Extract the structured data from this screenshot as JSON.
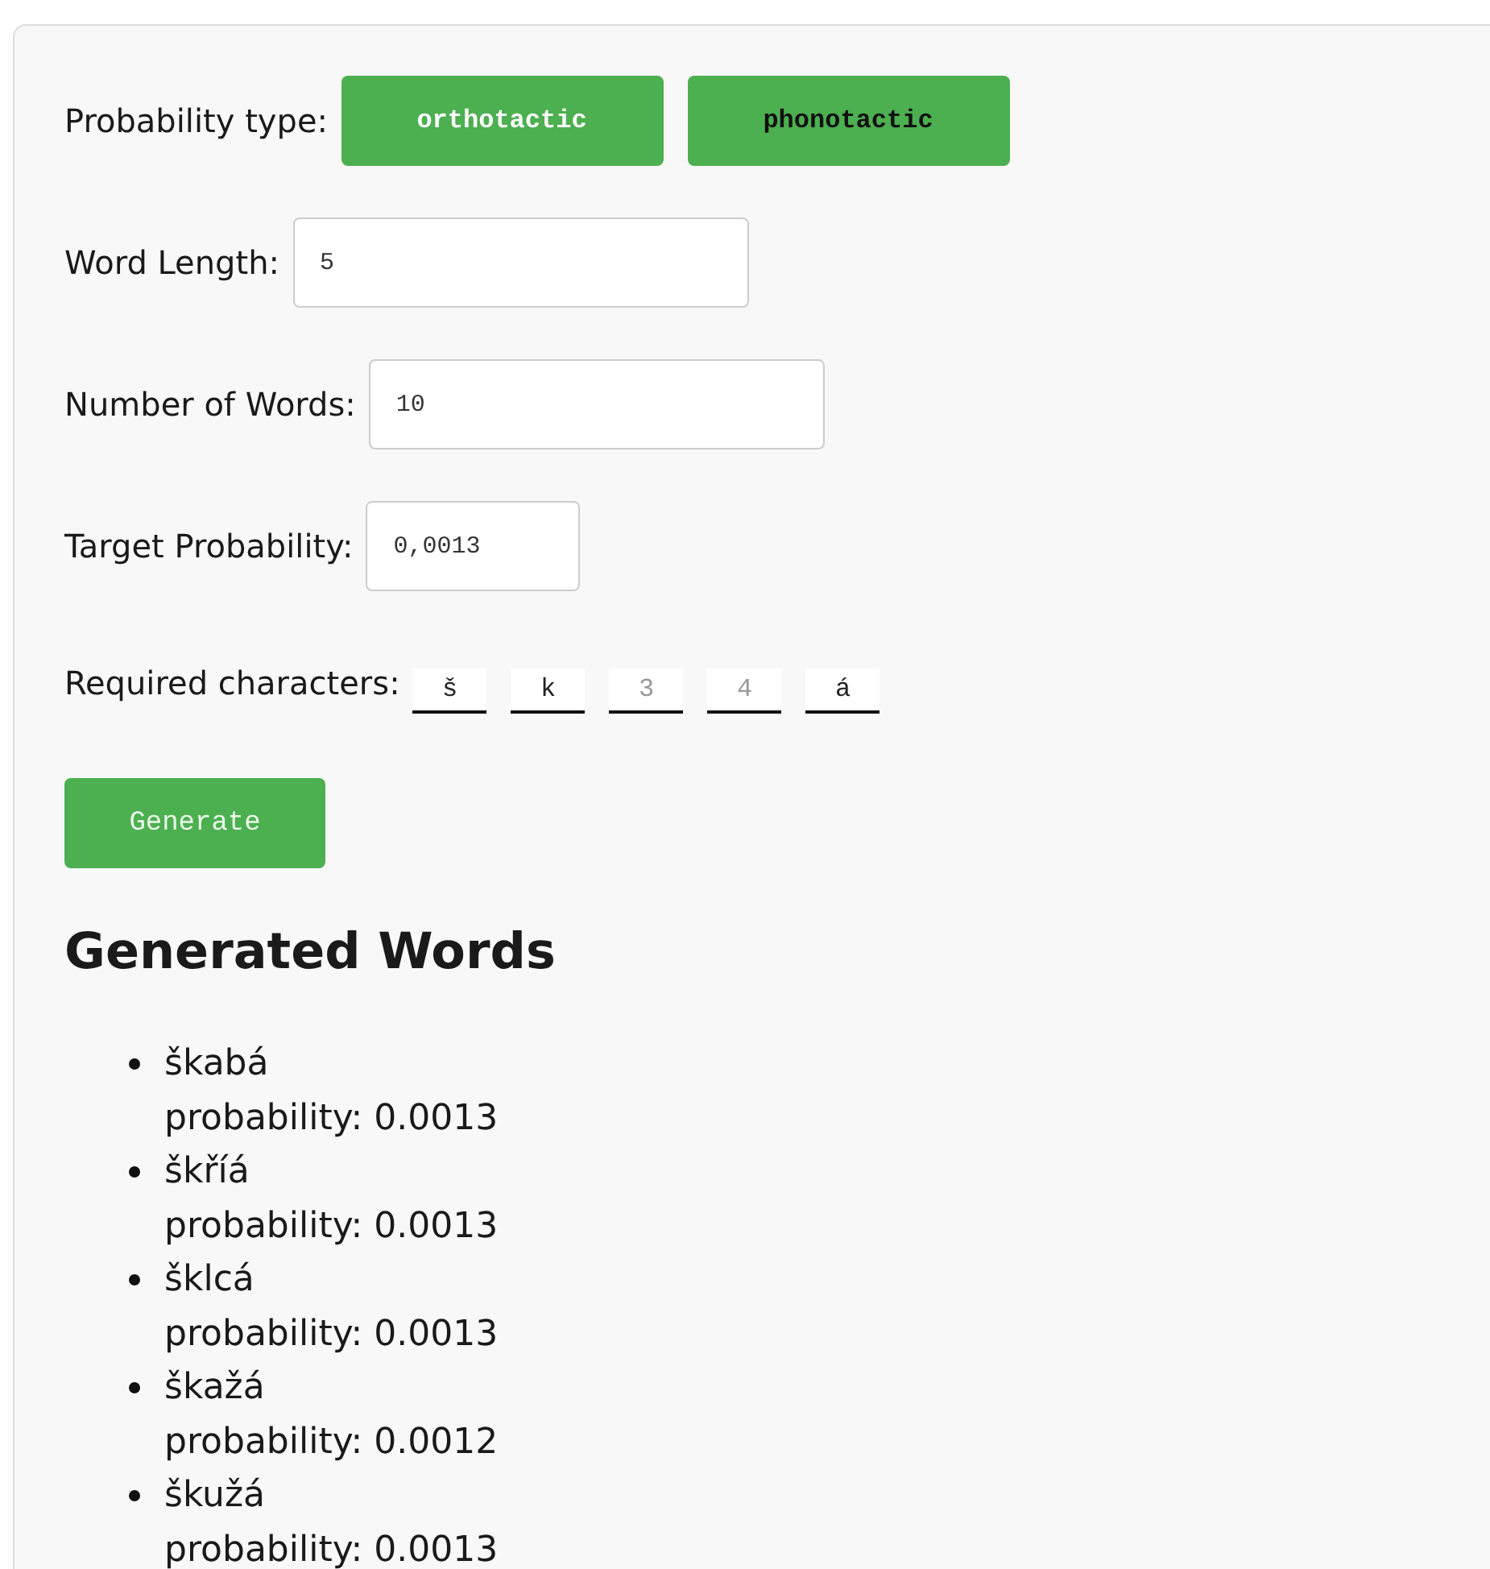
{
  "probability_type": {
    "label": "Probability type:",
    "options": [
      {
        "label": "orthotactic",
        "selected": true
      },
      {
        "label": "phonotactic",
        "selected": false
      }
    ]
  },
  "fields": [
    {
      "label": "Word Length:",
      "value": "5"
    },
    {
      "label": "Number of Words:",
      "value": "10"
    },
    {
      "label": "Target Probability:",
      "value": "0,0013"
    }
  ],
  "required_characters": {
    "label": "Required characters:",
    "slots": [
      {
        "value": "š"
      },
      {
        "value": "k"
      },
      {
        "placeholder": "3"
      },
      {
        "placeholder": "4"
      },
      {
        "value": "á"
      }
    ]
  },
  "generate_button": "Generate",
  "results": {
    "title": "Generated Words",
    "words": [
      {
        "word": "škabá",
        "probability": "probability: 0.0013"
      },
      {
        "word": "škříá",
        "probability": "probability: 0.0013"
      },
      {
        "word": "šklcá",
        "probability": "probability: 0.0013"
      },
      {
        "word": "škažá",
        "probability": "probability: 0.0012"
      },
      {
        "word": "škužá",
        "probability": "probability: 0.0013"
      }
    ]
  }
}
